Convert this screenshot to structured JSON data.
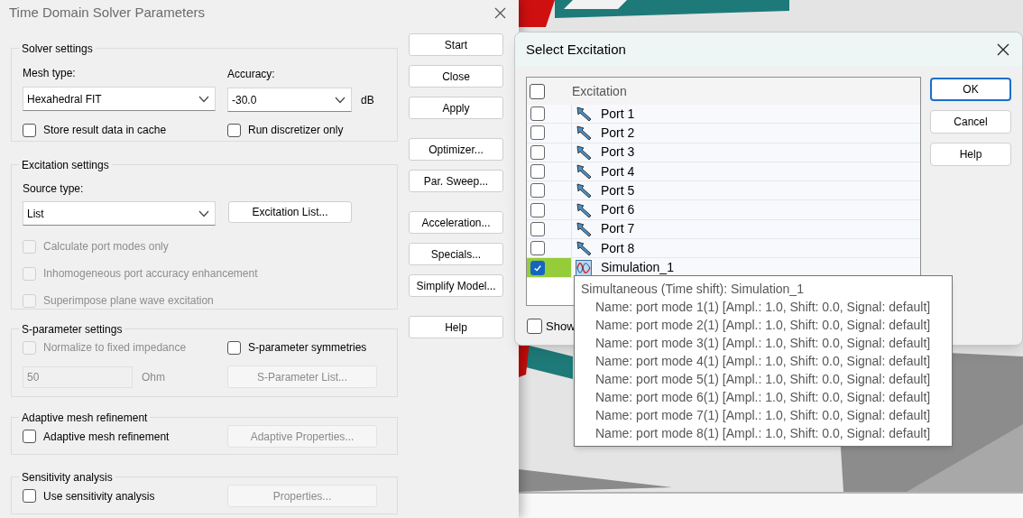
{
  "window": {
    "title": "Time Domain Solver Parameters"
  },
  "solver_settings": {
    "title": "Solver settings",
    "mesh_type": {
      "label": "Mesh type:",
      "value": "Hexahedral FIT"
    },
    "accuracy": {
      "label": "Accuracy:",
      "value": "-30.0",
      "unit": "dB"
    },
    "checkboxes": [
      {
        "label": "Store result data in cache",
        "checked": false,
        "disabled": false
      },
      {
        "label": "Run discretizer only",
        "checked": false,
        "disabled": false
      }
    ]
  },
  "excitation_settings": {
    "title": "Excitation settings",
    "source_type": {
      "label": "Source type:",
      "value": "List"
    },
    "button": {
      "label": "Excitation List...",
      "disabled": false
    },
    "checkboxes": [
      {
        "label": "Calculate port modes only",
        "checked": false,
        "disabled": true
      },
      {
        "label": "Inhomogeneous port accuracy enhancement",
        "checked": false,
        "disabled": true
      },
      {
        "label": "Superimpose plane wave excitation",
        "checked": false,
        "disabled": true
      }
    ]
  },
  "s_parameter_settings": {
    "title": "S-parameter settings",
    "checkboxes": [
      {
        "label": "Normalize to fixed impedance",
        "checked": false,
        "disabled": true
      },
      {
        "label": "S-parameter symmetries",
        "checked": false,
        "disabled": false
      }
    ],
    "impedance": {
      "value": "50",
      "unit": "Ohm",
      "disabled": true
    },
    "button": {
      "label": "S-Parameter List...",
      "disabled": true
    }
  },
  "adaptive_mesh_refinement": {
    "title": "Adaptive mesh refinement",
    "checkbox": {
      "label": "Adaptive mesh refinement",
      "checked": false,
      "disabled": false
    },
    "button": {
      "label": "Adaptive Properties...",
      "disabled": true
    }
  },
  "sensitivity_analysis": {
    "title": "Sensitivity analysis",
    "checkbox": {
      "label": "Use sensitivity analysis",
      "checked": false,
      "disabled": false
    },
    "button": {
      "label": "Properties...",
      "disabled": true
    }
  },
  "side_buttons": [
    [
      "Start",
      "Close",
      "Apply"
    ],
    [
      "Optimizer...",
      "Par. Sweep..."
    ],
    [
      "Acceleration...",
      "Specials...",
      "Simplify Model..."
    ],
    [
      "Help"
    ]
  ],
  "select_excitation": {
    "title": "Select Excitation",
    "header": {
      "label": "Excitation",
      "checked": false
    },
    "rows": [
      {
        "kind": "port",
        "label": "Port 1",
        "checked": false
      },
      {
        "kind": "port",
        "label": "Port 2",
        "checked": false
      },
      {
        "kind": "port",
        "label": "Port 3",
        "checked": false
      },
      {
        "kind": "port",
        "label": "Port 4",
        "checked": false
      },
      {
        "kind": "port",
        "label": "Port 5",
        "checked": false
      },
      {
        "kind": "port",
        "label": "Port 6",
        "checked": false
      },
      {
        "kind": "port",
        "label": "Port 7",
        "checked": false
      },
      {
        "kind": "port",
        "label": "Port 8",
        "checked": false
      },
      {
        "kind": "simulation",
        "label": "Simulation_1",
        "checked": true
      }
    ],
    "buttons": [
      {
        "label": "OK",
        "default": true
      },
      {
        "label": "Cancel",
        "default": false
      },
      {
        "label": "Help",
        "default": false
      }
    ],
    "show_checkbox": {
      "label": "Show",
      "checked": false
    }
  },
  "tooltip": {
    "title": "Simultaneous (Time shift): Simulation_1",
    "lines": [
      "Name: port mode 1(1) [Ampl.: 1.0, Shift: 0.0, Signal: default]",
      "Name: port mode 2(1) [Ampl.: 1.0, Shift: 0.0, Signal: default]",
      "Name: port mode 3(1) [Ampl.: 1.0, Shift: 0.0, Signal: default]",
      "Name: port mode 4(1) [Ampl.: 1.0, Shift: 0.0, Signal: default]",
      "Name: port mode 5(1) [Ampl.: 1.0, Shift: 0.0, Signal: default]",
      "Name: port mode 6(1) [Ampl.: 1.0, Shift: 0.0, Signal: default]",
      "Name: port mode 7(1) [Ampl.: 1.0, Shift: 0.0, Signal: default]",
      "Name: port mode 8(1) [Ampl.: 1.0, Shift: 0.0, Signal: default]"
    ]
  }
}
